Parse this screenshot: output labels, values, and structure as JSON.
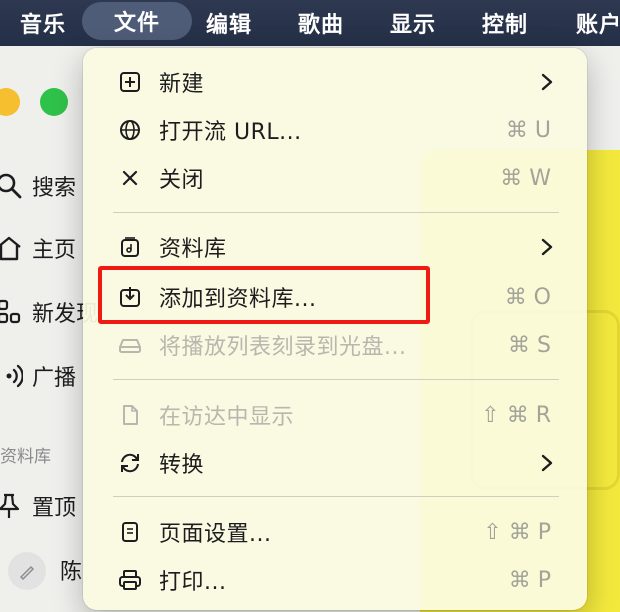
{
  "menubar": {
    "items": [
      {
        "label": "音乐",
        "active": false
      },
      {
        "label": "文件",
        "active": true
      },
      {
        "label": "编辑",
        "active": false
      },
      {
        "label": "歌曲",
        "active": false
      },
      {
        "label": "显示",
        "active": false
      },
      {
        "label": "控制",
        "active": false
      },
      {
        "label": "账户",
        "active": false
      }
    ]
  },
  "sidebar": {
    "items": [
      {
        "label": "搜索",
        "icon": "search-icon"
      },
      {
        "label": "主页",
        "icon": "home-icon"
      },
      {
        "label": "新发现",
        "icon": "grid-icon"
      },
      {
        "label": "广播",
        "icon": "radio-icon"
      }
    ],
    "library_section": "资料库",
    "library_items": [
      {
        "label": "置顶",
        "icon": "pin-icon"
      },
      {
        "label": "陈",
        "icon": "avatar"
      }
    ]
  },
  "file_menu": {
    "items": [
      {
        "label": "新建",
        "icon": "new-icon",
        "shortcut": "",
        "submenu": true,
        "disabled": false
      },
      {
        "label": "打开流 URL...",
        "icon": "globe-icon",
        "shortcut": "⌘ U",
        "submenu": false,
        "disabled": false
      },
      {
        "label": "关闭",
        "icon": "close-icon",
        "shortcut": "⌘ W",
        "submenu": false,
        "disabled": false
      },
      {
        "label": "资料库",
        "icon": "library-icon",
        "shortcut": "",
        "submenu": true,
        "disabled": false
      },
      {
        "label": "添加到资料库...",
        "icon": "add-to-library-icon",
        "shortcut": "⌘ O",
        "submenu": false,
        "disabled": false,
        "highlighted": true
      },
      {
        "label": "将播放列表刻录到光盘...",
        "icon": "disc-drive-icon",
        "shortcut": "⌘ S",
        "submenu": false,
        "disabled": true
      },
      {
        "label": "在访达中显示",
        "icon": "document-icon",
        "shortcut": "⇧ ⌘ R",
        "submenu": false,
        "disabled": true
      },
      {
        "label": "转换",
        "icon": "convert-icon",
        "shortcut": "",
        "submenu": true,
        "disabled": false
      },
      {
        "label": "页面设置...",
        "icon": "page-setup-icon",
        "shortcut": "⇧ ⌘ P",
        "submenu": false,
        "disabled": false
      },
      {
        "label": "打印...",
        "icon": "printer-icon",
        "shortcut": "⌘ P",
        "submenu": false,
        "disabled": false
      }
    ]
  },
  "colors": {
    "menubar": "#263149",
    "menu_background": "#fbfbe2",
    "highlight_border": "#ef1a14",
    "yellow_panel": "#f3e93d"
  }
}
